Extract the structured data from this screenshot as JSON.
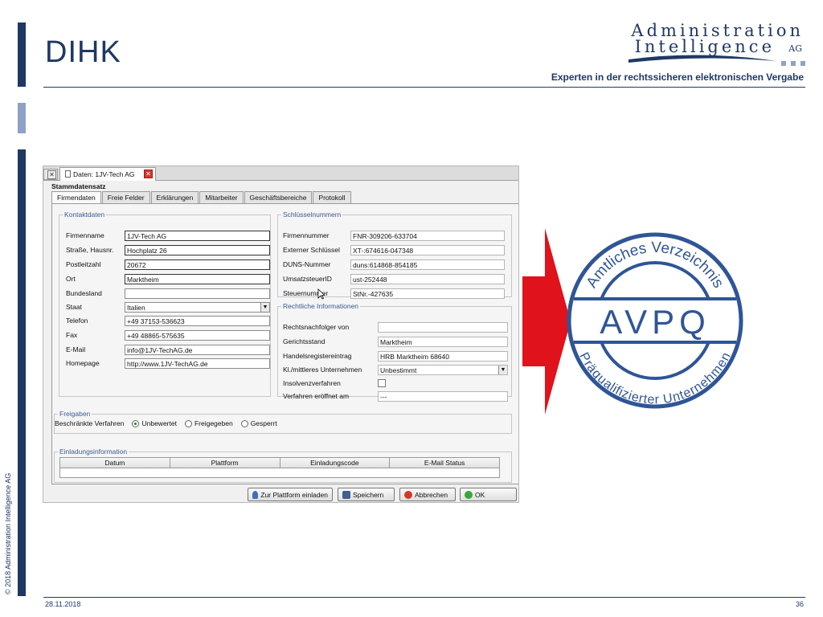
{
  "slide": {
    "title": "DIHK",
    "tagline": "Experten in der rechtssicheren elektronischen Vergabe",
    "logo_line1": "Administration",
    "logo_line2": "Intelligence",
    "logo_ag": "AG",
    "copyright": "© 2018 Administration Intelligence AG",
    "date": "28.11.2018",
    "page": "36",
    "colors": {
      "brand": "#1f3864",
      "accent": "#8ea2c8",
      "arrow": "#e0121b",
      "seal": "#2f5597"
    }
  },
  "app": {
    "doc_tab_title": "Daten: 1JV-Tech AG",
    "form_title": "Stammdatensatz",
    "tabs": [
      "Firmendaten",
      "Freie Felder",
      "Erklärungen",
      "Mitarbeiter",
      "Geschäftsbereiche",
      "Protokoll"
    ],
    "kontakt": {
      "legend": "Kontaktdaten",
      "rows": [
        {
          "label": "Firmenname",
          "value": "1JV-Tech AG"
        },
        {
          "label": "Straße, Hausnr.",
          "value": "Hochplatz 26"
        },
        {
          "label": "Postleitzahl",
          "value": "20672"
        },
        {
          "label": "Ort",
          "value": "Marktheim"
        },
        {
          "label": "Bundesland",
          "value": ""
        },
        {
          "label": "Staat",
          "value": "Italien"
        },
        {
          "label": "Telefon",
          "value": "+49 37153-536623"
        },
        {
          "label": "Fax",
          "value": "+49 48865-575635"
        },
        {
          "label": "E-Mail",
          "value": "info@1JV-TechAG.de"
        },
        {
          "label": "Homepage",
          "value": "http://www.1JV-TechAG.de"
        }
      ]
    },
    "schluessel": {
      "legend": "Schlüsselnummern",
      "rows": [
        {
          "label": "Firmennummer",
          "value": "FNR-309206-633704"
        },
        {
          "label": "Externer Schlüssel",
          "value": "XT-:674616-047348"
        },
        {
          "label": "DUNS-Nummer",
          "value": "duns:614868-854185"
        },
        {
          "label": "UmsatzsteuerID",
          "value": "ust-252448"
        },
        {
          "label": "Steuernummer",
          "value": "StNr.-427635"
        }
      ]
    },
    "rechtlich": {
      "legend": "Rechtliche Informationen",
      "rows": [
        {
          "label": "Rechtsnachfolger von",
          "value": ""
        },
        {
          "label": "Gerichtsstand",
          "value": "Marktheim"
        },
        {
          "label": "Handelsregistereintrag",
          "value": "HRB Marktheim 68640"
        },
        {
          "label": "Kl./mittleres Unternehmen",
          "value": "Unbestimmt"
        },
        {
          "label": "Insolvenzverfahren",
          "value": ""
        },
        {
          "label": "Verfahren eröffnet am",
          "value": "---"
        }
      ]
    },
    "freigaben": {
      "legend": "Freigaben",
      "label": "Beschränkte Verfahren",
      "options": [
        "Unbewertet",
        "Freigegeben",
        "Gesperrt"
      ],
      "selected": "Unbewertet"
    },
    "einladung": {
      "legend": "Einladungsinformation",
      "columns": [
        "Datum",
        "Plattform",
        "Einladungscode",
        "E-Mail Status"
      ]
    },
    "buttons": {
      "invite": "Zur Plattform einladen",
      "save": "Speichern",
      "cancel": "Abbrechen",
      "ok": "OK"
    }
  },
  "seal": {
    "top_text": "Amtliches Verzeichnis",
    "center_text": "AVPQ",
    "bottom_text": "Präqualifizierter Unternehmen"
  }
}
